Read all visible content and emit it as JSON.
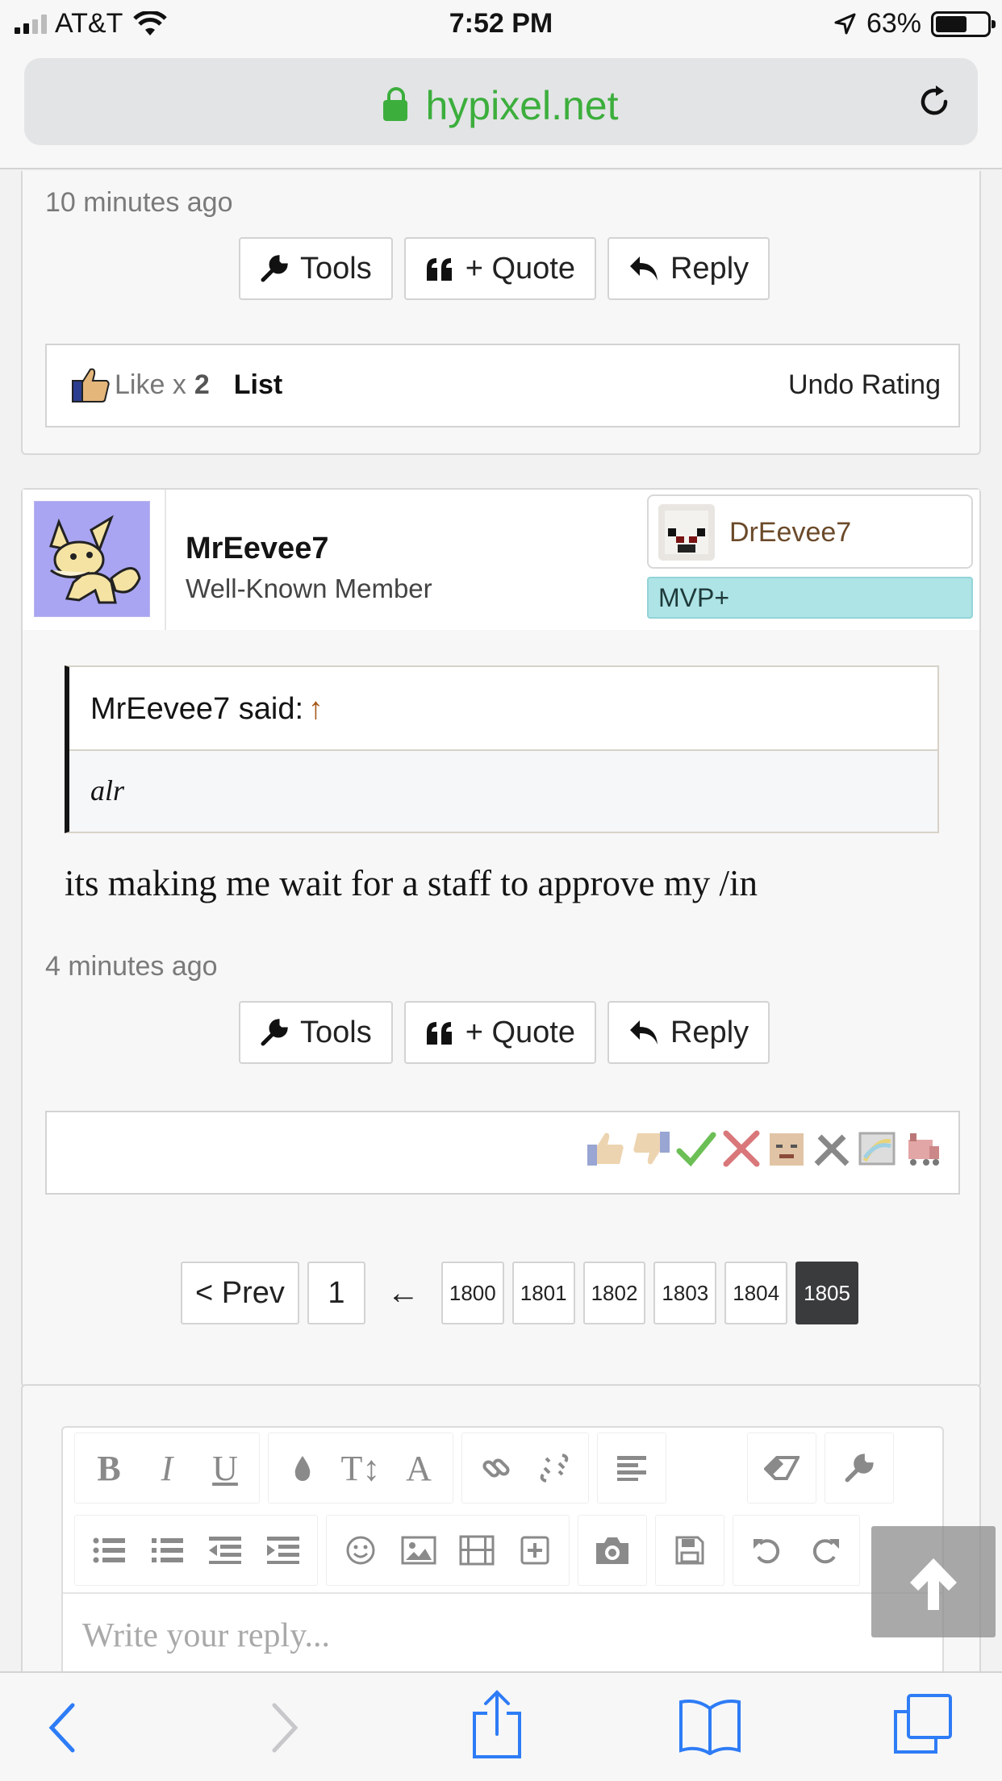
{
  "status_bar": {
    "carrier": "AT&T",
    "time": "7:52 PM",
    "battery": "63%",
    "battery_level": 0.63
  },
  "browser": {
    "domain": "hypixel.net",
    "lock_icon": "lock-icon",
    "reload_icon": "reload-icon"
  },
  "post1": {
    "timestamp": "10 minutes ago",
    "actions": {
      "tools": "Tools",
      "quote": "+ Quote",
      "reply": "Reply"
    },
    "like_text": "Like x",
    "like_count": "2",
    "list_label": "List",
    "undo_label": "Undo Rating"
  },
  "post2": {
    "username": "MrEevee7",
    "user_title": "Well-Known Member",
    "ign": "DrEevee7",
    "rank": "MVP+",
    "quote_author": "MrEevee7 said:",
    "quote_arrow": "↑",
    "quote_text": "alr",
    "message": "its making me wait for a staff to approve my /in",
    "timestamp": "4 minutes ago",
    "actions": {
      "tools": "Tools",
      "quote": "+ Quote",
      "reply": "Reply"
    },
    "rating_icons": [
      "like-icon",
      "dislike-icon",
      "agree-icon",
      "disagree-icon",
      "funny-icon",
      "tools-icon",
      "rainbow-icon",
      "train-icon"
    ]
  },
  "pagination": {
    "prev": "< Prev",
    "first": "1",
    "arrow": "←",
    "pages": [
      "1800",
      "1801",
      "1802",
      "1803",
      "1804",
      "1805"
    ],
    "current": "1805"
  },
  "editor": {
    "placeholder": "Write your reply...",
    "toolbar_row1": [
      "B",
      "I",
      "U",
      "color",
      "T↕",
      "A",
      "link",
      "unlink",
      "align",
      "eraser",
      "wrench"
    ],
    "toolbar_row2": [
      "bullets",
      "numbered",
      "outdent",
      "indent",
      "smile",
      "image",
      "media",
      "insert",
      "camera",
      "save",
      "undo",
      "redo"
    ]
  },
  "colors": {
    "accent_green": "#3cae3c",
    "rank_bg": "#aee4e6",
    "current_page": "#3a3b3d",
    "ios_blue": "#2e7cf6"
  }
}
